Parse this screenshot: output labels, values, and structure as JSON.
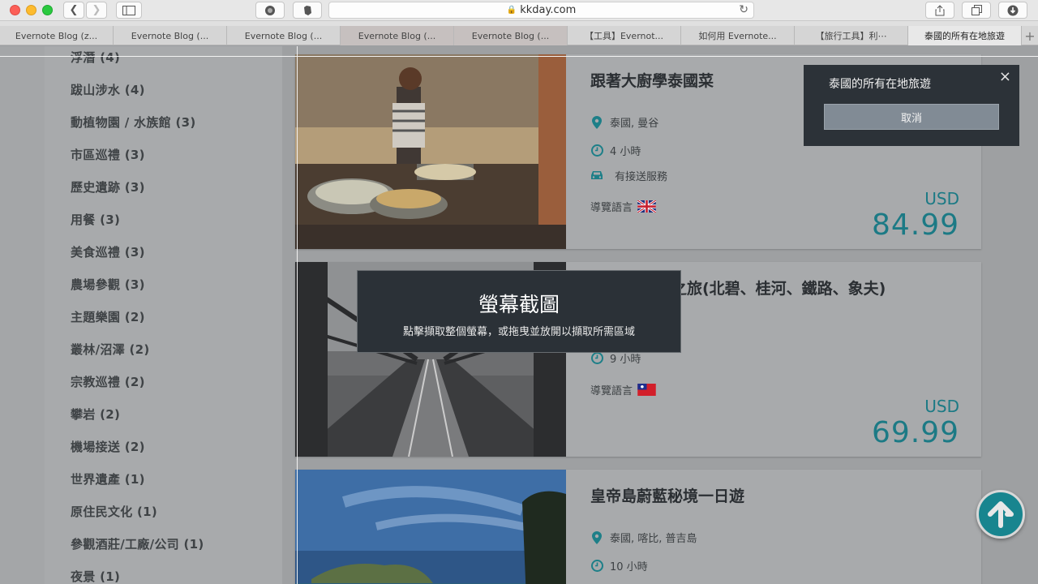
{
  "browser": {
    "url": "kkday.com",
    "tabs": [
      "Evernote Blog (z...",
      "Evernote Blog (...",
      "Evernote Blog (...",
      "Evernote Blog (...",
      "Evernote Blog (...",
      "【工具】Evernot...",
      "如何用 Evernote...",
      "【旅行工具】利⋯",
      "泰國的所有在地旅遊"
    ],
    "active_tab": 8,
    "new_tab_label": "+"
  },
  "sidebar": {
    "categories": [
      "浮潛 (4)",
      "跋山涉水 (4)",
      "動植物園 / 水族館 (3)",
      "市區巡禮 (3)",
      "歷史遺跡 (3)",
      "用餐 (3)",
      "美食巡禮 (3)",
      "農場參觀 (3)",
      "主題樂園 (2)",
      "叢林/沼澤 (2)",
      "宗教巡禮 (2)",
      "攀岩 (2)",
      "機場接送 (2)",
      "世界遺產 (1)",
      "原住民文化 (1)",
      "參觀酒莊/工廠/公司 (1)",
      "夜景 (1)"
    ]
  },
  "products": [
    {
      "title": "跟著大廚學泰國菜",
      "location": "泰國, 曼谷",
      "duration": "4 小時",
      "service": "有接送服務",
      "language_label": "導覽語言",
      "language_flag": "uk-flag",
      "currency": "USD",
      "price": "84.99"
    },
    {
      "title": "境之旅(北碧、桂河、鐵路、象夫)",
      "duration": "9 小時",
      "language_label": "導覽語言",
      "language_flag": "taiwan-flag",
      "currency": "USD",
      "price": "69.99"
    },
    {
      "title": "皇帝島蔚藍秘境一日遊",
      "location": "泰國, 喀比, 普吉島",
      "duration": "10 小時"
    }
  ],
  "popup": {
    "title": "泰國的所有在地旅遊",
    "cancel_label": "取消",
    "close_label": "×"
  },
  "screenshot_hud": {
    "title": "螢幕截圖",
    "subtitle": "點擊擷取整個螢幕，或拖曳並放開以擷取所需區域"
  },
  "colors": {
    "accent": "#1c7a85",
    "popup_bg": "#2c3238"
  }
}
